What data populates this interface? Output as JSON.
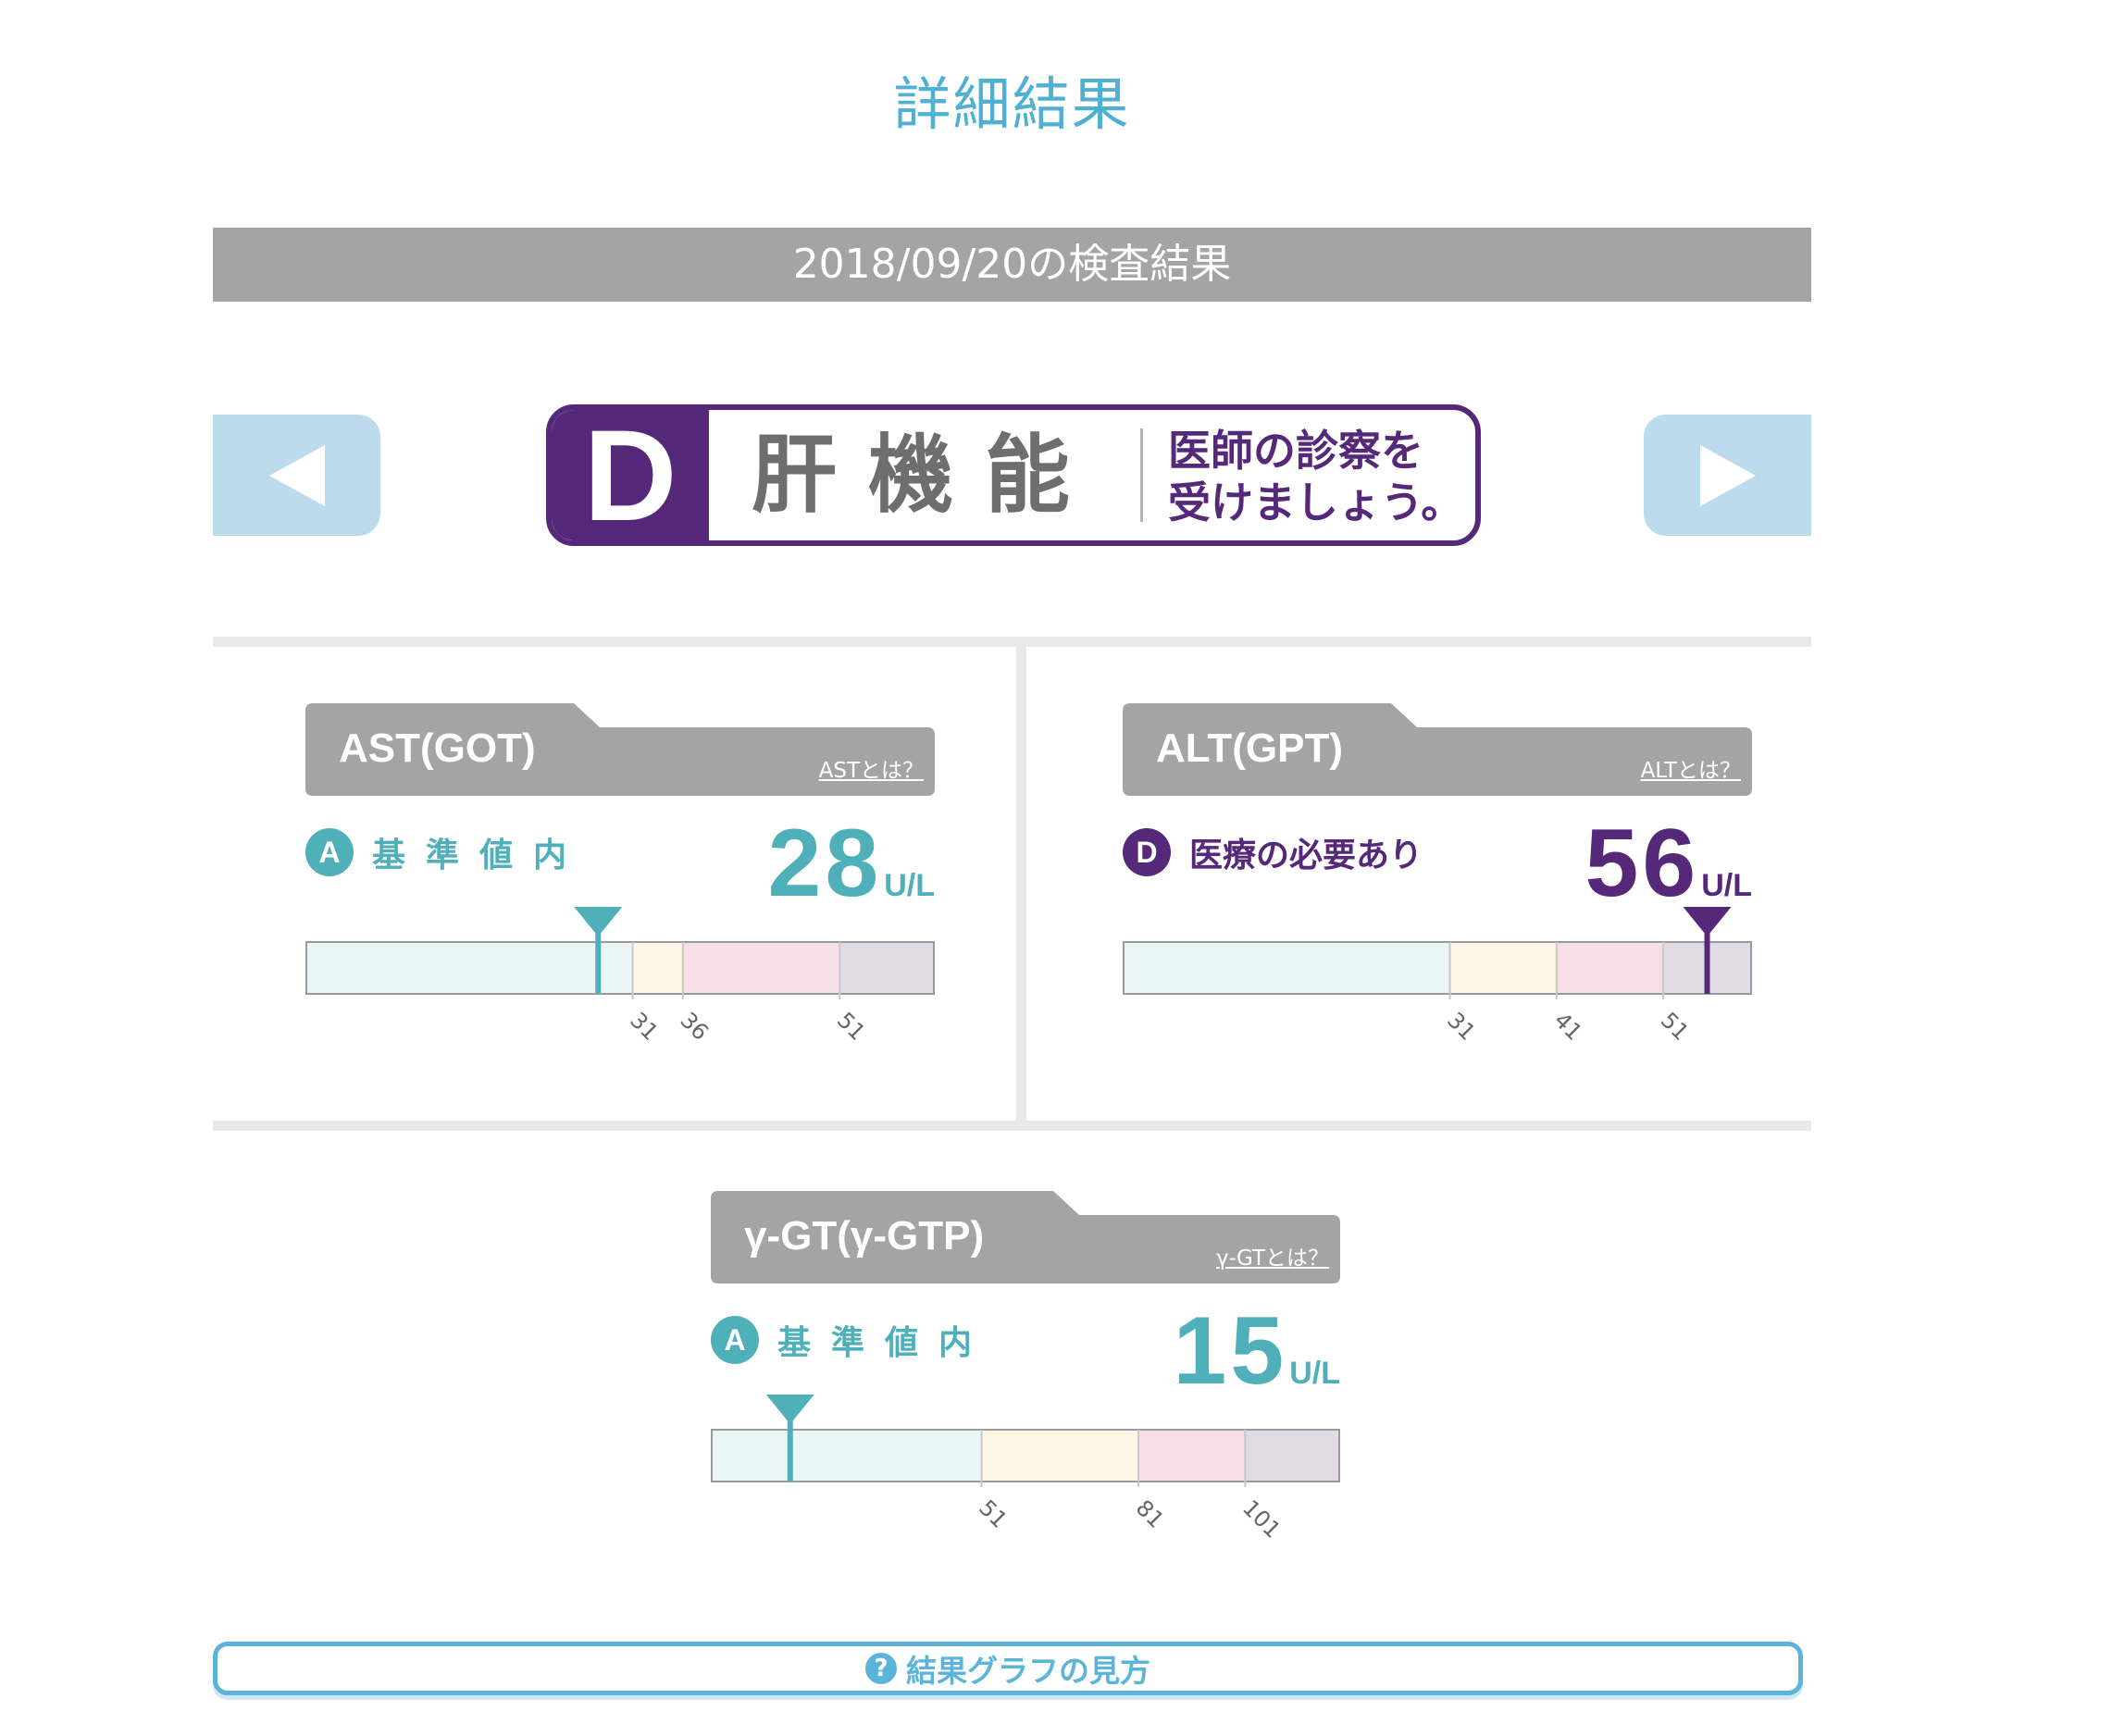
{
  "page": {
    "title": "詳細結果"
  },
  "date_bar": {
    "label": "2018/09/20の検査結果"
  },
  "nav": {
    "prev_icon": "triangle-left-icon",
    "next_icon": "triangle-right-icon"
  },
  "grade_banner": {
    "grade": "D",
    "category": "肝機能",
    "message_line1": "医師の診察を",
    "message_line2": "受けましょう。",
    "color": "#55287a"
  },
  "colors": {
    "teal": "#4fb0b9",
    "purple": "#55287a",
    "zone_normal": "#e9f5f6",
    "zone_caution": "#fdf6e4",
    "zone_warning": "#f6dfe6",
    "zone_danger": "#e2dbe6",
    "tab_gray": "#a4a4a4",
    "accent_blue": "#5bb4da"
  },
  "tests": [
    {
      "id": "ast",
      "title": "AST(GOT)",
      "link": "ASTとは？",
      "grade": "A",
      "status": "基準値内",
      "value": "28",
      "unit": "U/L",
      "zone_fractions": [
        0.52,
        0.08,
        0.25,
        0.15
      ],
      "marker_fraction": 0.465,
      "ticks": [
        "31",
        "36",
        "51"
      ],
      "accent": "#4fb0b9"
    },
    {
      "id": "alt",
      "title": "ALT(GPT)",
      "link": "ALTとは？",
      "grade": "D",
      "status": "医療の必要あり",
      "value": "56",
      "unit": "U/L",
      "zone_fractions": [
        0.52,
        0.17,
        0.17,
        0.14
      ],
      "marker_fraction": 0.93,
      "ticks": [
        "31",
        "41",
        "51"
      ],
      "accent": "#55287a"
    },
    {
      "id": "ggt",
      "title": "γ-GT(γ-GTP)",
      "link": "γ-GTとは？",
      "grade": "A",
      "status": "基準値内",
      "value": "15",
      "unit": "U/L",
      "zone_fractions": [
        0.43,
        0.25,
        0.17,
        0.15
      ],
      "marker_fraction": 0.125,
      "ticks": [
        "51",
        "81",
        "101"
      ],
      "accent": "#4fb0b9"
    }
  ],
  "how_to": {
    "icon": "question-circle-icon",
    "icon_glyph": "?",
    "label": "結果グラフの見方"
  }
}
